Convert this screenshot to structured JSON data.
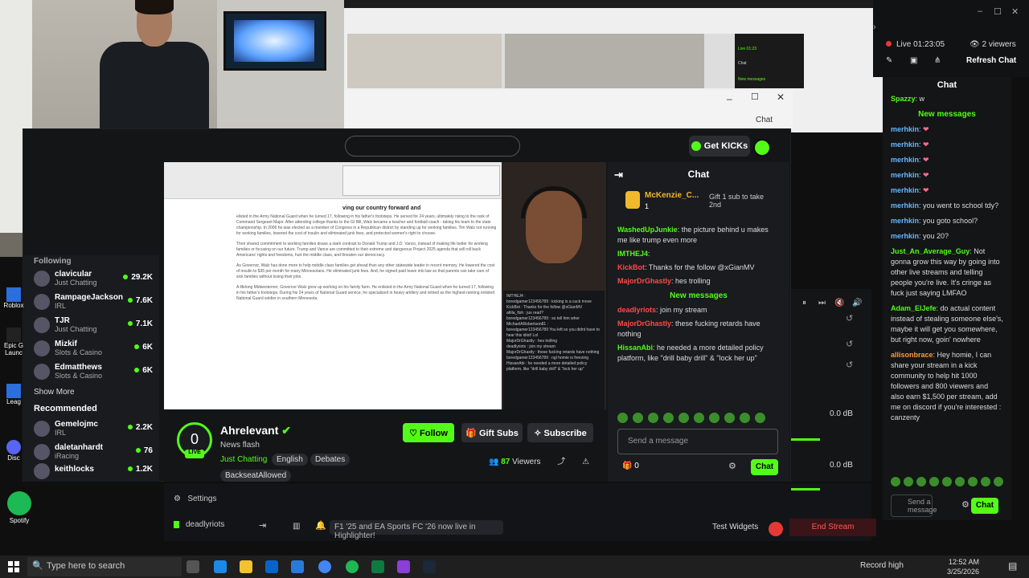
{
  "nested_chat": {
    "header": "Chat",
    "live": "Live 01:23",
    "refresh": "Refresh Chat",
    "new_messages": "New messages",
    "browser_chat": "Chat"
  },
  "doc": {
    "title": "ving our country forward and",
    "paragraph1": "elisted in the Army National Guard when he turned 17, following in his father's footsteps. He served for 24 years, ultimately rising to the rank of Command Sergeant Major. After attending college thanks to the GI Bill, Walz became a teacher and football coach - taking his team to the state championship. In 2006 he was elected as a member of Congress in a Republican district by standing up for working families. Tim Walz not running for working families, lowered the cost of insulin and eliminated junk fees, and protected women's right to choose.",
    "paragraph2": "Their shared commitment to working families draws a stark contrast to Donald Trump and J.D. Vance, instead of making life better for working families or focusing on our future. Trump and Vance are committed to their extreme and dangerous Project 2025 agenda that will roll back Americans' rights and freedoms, hurt the middle class, and threaten our democracy.",
    "paragraph3": "As Governor, Walz has done more to help middle class families get ahead than any other statewide leader in recent memory. He lowered the cost of insulin to $35 per month for many Minnesotans. He eliminated junk fees. And, he signed paid leave into law so that parents can take care of sick families without losing their jobs.",
    "paragraph4": "A lifelong Midwesterner, Governor Walz grew up working on his family farm. He enlisted in the Army National Guard when he turned 17, following in his father's footsteps. During his 24 years of National Guard service, he specialized in heavy artillery and retired as the highest-ranking enlisted National Guard soldier in southern Minnesota."
  },
  "mini_chat": [
    "IMTHEJ4 :",
    "boredgamer123456789 : kicking is a cuck move",
    "KickBot : Thanks for the follow @xGianMV",
    "attila_fish : jus read?",
    "boredgamer123456789 : so tell him wher",
    "MichaelARobertson81 :",
    "boredgamer123456789 You left so you didnt have to hear this idiot! Lol",
    "MajorDrGhastly : hes trolling",
    "deadlyriots : join my stream",
    "MajorDrGhastly : these fucking retards have nothing",
    "boredgamer123456789 : ngl homie is freezing",
    "HissanAbi : he needed a more detailed policy platform, like \"drill baby drill\" & \"lock her up\""
  ],
  "sidebar": {
    "header": "Following",
    "following": [
      {
        "name": "clavicular",
        "category": "Just Chatting",
        "viewers": "29.2K"
      },
      {
        "name": "RampageJackson",
        "category": "IRL",
        "viewers": "7.6K"
      },
      {
        "name": "TJR",
        "category": "Just Chatting",
        "viewers": "7.1K"
      },
      {
        "name": "Mizkif",
        "category": "Slots & Casino",
        "viewers": "6K"
      },
      {
        "name": "Edmatthews",
        "category": "Slots & Casino",
        "viewers": "6K"
      }
    ],
    "show_more": "Show More",
    "recommended_label": "Recommended",
    "recommended": [
      {
        "name": "Gemelojmc",
        "category": "IRL",
        "viewers": "2.2K"
      },
      {
        "name": "daletanhardt",
        "category": "iRacing",
        "viewers": "76"
      },
      {
        "name": "keithlocks",
        "category": "",
        "viewers": "1.2K"
      }
    ]
  },
  "topbar": {
    "get_kicks": "Get KICKs"
  },
  "kick_chat": {
    "header": "Chat",
    "pinned_user": "McKenzie_C...",
    "pinned_count": "1",
    "pinned_gift": "Gift 1 sub to take 2nd",
    "messages": [
      {
        "user": "WashedUpJunkie",
        "text": "the picture behind u makes me like trump even more",
        "color": "green"
      },
      {
        "user": "IMTHEJ4",
        "text": "",
        "color": "green"
      },
      {
        "user": "KickBot",
        "text": "Thanks for the follow @xGianMV",
        "color": "red"
      },
      {
        "user": "MajorDrGhastly",
        "text": "hes trolling",
        "color": "red"
      }
    ],
    "new_messages": "New messages",
    "messages2": [
      {
        "user": "deadlyriots",
        "text": "join my stream",
        "color": "red"
      },
      {
        "user": "MajorDrGhastly",
        "text": "these fucking retards have nothing",
        "color": "red"
      },
      {
        "user": "HissanAbi",
        "text": "he needed a more detailed policy platform, like \"drill baby drill\" & \"lock her up\"",
        "color": "green"
      }
    ],
    "send_placeholder": "Send a message",
    "gift_count": "0",
    "chat_button": "Chat"
  },
  "streamer": {
    "name": "Ahrelevant",
    "live_badge": "LIVE",
    "count": "0",
    "title": "News flash",
    "category": "Just Chatting",
    "tags": [
      "English",
      "Debates",
      "BackseatAllowed"
    ],
    "follow": "Follow",
    "gift_subs": "Gift Subs",
    "subscribe": "Subscribe",
    "viewers_count": "87",
    "viewers_label": "Viewers"
  },
  "studio": {
    "settings": "Settings",
    "channel": "deadlyriots",
    "notification": "F1 '25 and EA Sports FC '26 now live in Highlighter!",
    "notification_highlight": "Highlighter!",
    "test_widgets": "Test Widgets",
    "end_stream": "End Stream",
    "db1": "0.0 dB",
    "db2": "0.0 dB"
  },
  "right_panel": {
    "live_time": "Live 01:23:05",
    "viewers": "2 viewers",
    "refresh": "Refresh Chat",
    "chat_title": "Chat",
    "first_msg_user": "Spazzy",
    "first_msg_text": "w",
    "new_messages": "New messages",
    "messages": [
      {
        "user": "merhkin",
        "text": "",
        "style": "blu"
      },
      {
        "user": "merhkin",
        "text": "",
        "style": "blu"
      },
      {
        "user": "merhkin",
        "text": "",
        "style": "blu"
      },
      {
        "user": "merhkin",
        "text": "",
        "style": "blu"
      },
      {
        "user": "merhkin",
        "text": "",
        "style": "blu"
      },
      {
        "user": "merhkin",
        "text": "you went to school tdy?",
        "style": "blu"
      },
      {
        "user": "merhkin",
        "text": "you goto school?",
        "style": "blu"
      },
      {
        "user": "merhkin",
        "text": "you 20?",
        "style": "blu"
      },
      {
        "user": "Just_An_Average_Guy",
        "text": "Not gonna grow this way by going into other live streams and telling people you're live. It's cringe as fuck just saying LMFAO",
        "style": "grn"
      },
      {
        "user": "Adam_ElJefe",
        "text": "do actual content instead of stealing someone else's, maybe it will get you somewhere, but right now, goin' nowhere",
        "style": "grn"
      },
      {
        "user": "allisonbrace",
        "text": "Hey homie, I can share your stream in a kick community to help hit 1000 followers and 800 viewers and also earn $1,500 per stream, add me on discord if you're interested : canzenty",
        "style": "org"
      }
    ],
    "send_placeholder": "Send a message",
    "chat_button": "Chat"
  },
  "desktop": {
    "spotify": "Spotify",
    "roblox": "Roblox",
    "epic": "Epic G Launc",
    "league": "Leag",
    "discord": "Disc",
    "studio": "Stud"
  },
  "taskbar": {
    "search_placeholder": "Type here to search",
    "record": "Record high",
    "time": "12:52 AM",
    "date": "3/25/2026"
  },
  "colors": {
    "kick_green": "#53fc18",
    "bg_dark": "#141517",
    "red": "#ff4a4a",
    "end_stream": "#ff5a5a"
  }
}
